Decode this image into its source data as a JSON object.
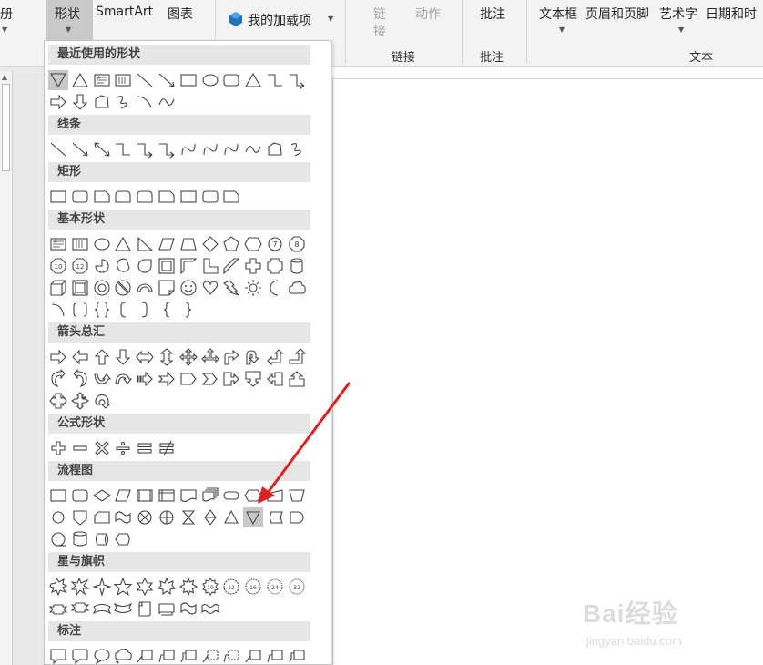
{
  "ribbon": {
    "cut_label": "册",
    "shape_label": "形状",
    "smartart_label": "SmartArt",
    "chart_label": "图表",
    "addins_label": "我的加载项",
    "link_label_1": "链",
    "link_label_2": "接",
    "action_label": "动作",
    "comment_label": "批注",
    "textbox_label": "文本框",
    "header_footer_label": "页眉和页脚",
    "wordart_label": "艺术字",
    "datetime_label": "日期和时",
    "group_links": "链接",
    "group_comments": "批注",
    "group_text": "文本"
  },
  "gallery": {
    "sections": [
      {
        "title": "最近使用的形状"
      },
      {
        "title": "线条"
      },
      {
        "title": "矩形"
      },
      {
        "title": "基本形状"
      },
      {
        "title": "箭头总汇"
      },
      {
        "title": "公式形状"
      },
      {
        "title": "流程图"
      },
      {
        "title": "星与旗帜"
      },
      {
        "title": "标注"
      }
    ],
    "selected_shape": "flowchart-merge"
  },
  "watermark": {
    "brand": "Bai经验",
    "url": "jingyan.baidu.com"
  },
  "colors": {
    "annotation_arrow": "#e02020",
    "selection": "#c8c8c8"
  }
}
